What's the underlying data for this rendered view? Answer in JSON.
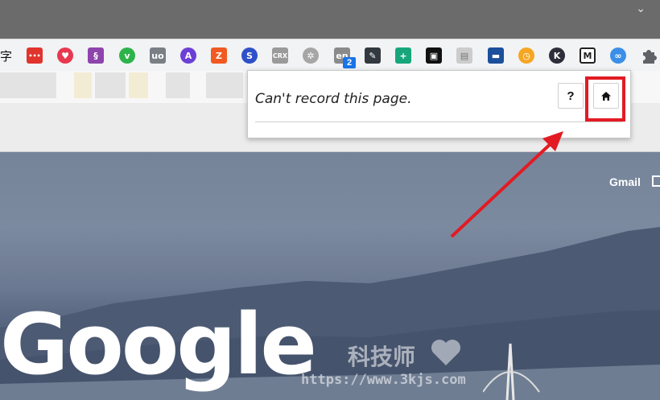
{
  "browser": {
    "titlebar": {
      "menu_chevron": "⌄"
    },
    "toolbar": {
      "cut_text": "字",
      "extensions": [
        {
          "name": "ext-red-dots",
          "glyph": "•••",
          "color": "#e0342d"
        },
        {
          "name": "ext-pink-fox",
          "glyph": "♥",
          "color": "#e8384f"
        },
        {
          "name": "ext-purple-s",
          "glyph": "§",
          "color": "#8e44ad"
        },
        {
          "name": "ext-green-v",
          "glyph": "v",
          "color": "#2db34a"
        },
        {
          "name": "ext-ublock",
          "glyph": "uo",
          "color": "#7a7f86"
        },
        {
          "name": "ext-purple-a",
          "glyph": "A",
          "color": "#6c3fd6"
        },
        {
          "name": "ext-orange-z",
          "glyph": "Z",
          "color": "#f05a22"
        },
        {
          "name": "ext-blue-swirl",
          "glyph": "S",
          "color": "#2e50c8"
        },
        {
          "name": "ext-crx",
          "glyph": "CRX",
          "color": "#9a9a9a"
        },
        {
          "name": "ext-gray-circle",
          "glyph": "✲",
          "color": "#a6a6a6"
        },
        {
          "name": "ext-en",
          "glyph": "en",
          "color": "#8a8a8a"
        },
        {
          "name": "ext-dark-wrench",
          "glyph": "✎",
          "color": "#333940"
        },
        {
          "name": "ext-teal-plus",
          "glyph": "+",
          "color": "#17a67b"
        },
        {
          "name": "ext-black-glasses",
          "glyph": "▣",
          "color": "#111111"
        },
        {
          "name": "ext-gray-doc",
          "glyph": "▤",
          "color": "#cccccc"
        },
        {
          "name": "ext-blue-flag",
          "glyph": "▬",
          "color": "#1c4f9c"
        },
        {
          "name": "ext-orange-clock",
          "glyph": "◷",
          "color": "#f5a623"
        },
        {
          "name": "ext-dark-k",
          "glyph": "K",
          "color": "#2c2f3a"
        },
        {
          "name": "ext-m",
          "glyph": "M",
          "color": "#333333"
        },
        {
          "name": "ext-active-recorder",
          "glyph": "∞",
          "color": "#3b8fe8"
        }
      ],
      "badge_count": "2",
      "puzzle_icon": "✚"
    }
  },
  "page": {
    "gmail_link": "Gmail",
    "logo_text": "Google",
    "watermark": {
      "cn_text": "科技师",
      "url_text": "https://www.3kjs.com"
    }
  },
  "popup": {
    "message": "Can't record this page.",
    "help_label": "?",
    "home_icon": "home-icon"
  },
  "annotation": {
    "highlight_color": "#e21b23"
  }
}
